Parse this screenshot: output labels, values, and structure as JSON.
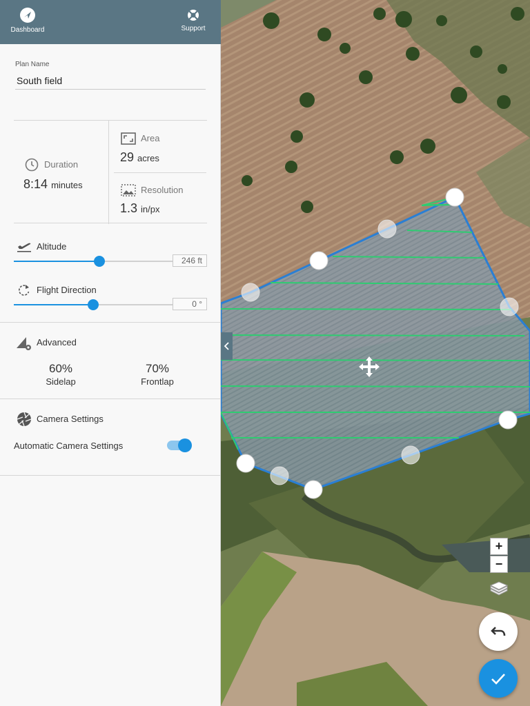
{
  "header": {
    "dashboard_label": "Dashboard",
    "support_label": "Support"
  },
  "plan": {
    "label": "Plan Name",
    "name": "South field"
  },
  "stats": {
    "duration_label": "Duration",
    "duration_value": "8:14",
    "duration_unit": "minutes",
    "area_label": "Area",
    "area_value": "29",
    "area_unit": "acres",
    "resolution_label": "Resolution",
    "resolution_value": "1.3",
    "resolution_unit": "in/px"
  },
  "altitude": {
    "label": "Altitude",
    "value": "246 ft",
    "level": 0.54
  },
  "flight_direction": {
    "label": "Flight Direction",
    "value": "0 °",
    "level": 0.5
  },
  "advanced": {
    "label": "Advanced",
    "sidelap_value": "60%",
    "sidelap_label": "Sidelap",
    "frontlap_value": "70%",
    "frontlap_label": "Frontlap"
  },
  "camera": {
    "label": "Camera Settings",
    "auto_label": "Automatic Camera Settings",
    "auto_enabled": true
  },
  "map": {
    "zoom_in": "+",
    "zoom_out": "−"
  },
  "icons": {
    "dashboard": "compass-icon",
    "support": "lifebuoy-icon",
    "duration": "clock-icon",
    "area": "area-frame-icon",
    "resolution": "resolution-icon",
    "altitude": "airplane-takeoff-icon",
    "flight_direction": "rotate-icon",
    "advanced": "settings-gear-icon",
    "camera": "camera-aperture-icon",
    "layers": "layers-icon",
    "undo": "undo-icon",
    "confirm": "checkmark-icon",
    "move": "move-arrows-icon"
  },
  "colors": {
    "header": "#5a7684",
    "accent": "#1a91e0",
    "polygon_border": "#2a7fd4",
    "flight_lines": "#2ecc71"
  }
}
